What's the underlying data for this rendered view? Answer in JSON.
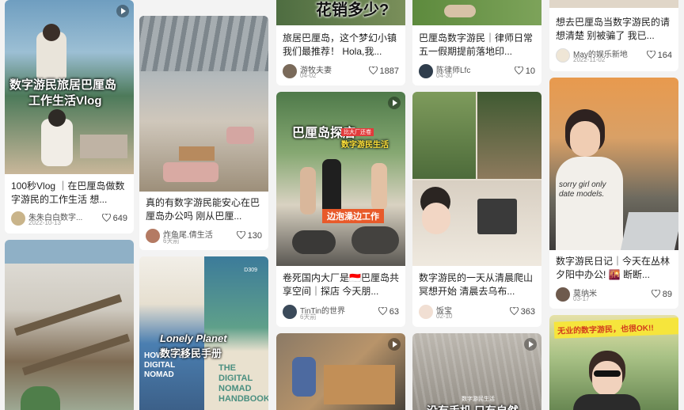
{
  "feed": {
    "col1": [
      {
        "overlay": "数字游民旅居巴厘岛",
        "overlay2": "工作生活Vlog",
        "title": "100秒Vlog ｜在巴厘岛做数字游民的工作生活 想...",
        "author": "朱朱白白数字...",
        "date": "2022-10-13",
        "likes": "649",
        "colors": [
          "#5f8aa6",
          "#3f6a50",
          "#c9b79a"
        ]
      },
      {
        "title": "",
        "colors": [
          "#d9d6cf",
          "#6d5f4a",
          "#a8b5a0"
        ]
      }
    ],
    "col2": [
      {
        "title": "真的有数字游民能安心在巴厘岛办公吗 刚从巴厘...",
        "author": "炸鱼尾.倩生活",
        "date": "6天前",
        "likes": "130",
        "colors": [
          "#9aa3a8",
          "#d6b0a8",
          "#c9a27b"
        ]
      },
      {
        "overlay": "Lonely Planet",
        "overlay2": "数字移民手册",
        "book1": "HOW TO BE A DIGITAL NOMAD",
        "book2": "THE DIGITAL NOMAD HANDBOOK",
        "code": "D309",
        "colors": [
          "#3e6fa6",
          "#e8e2d4",
          "#4f8f7a"
        ]
      }
    ],
    "col3": [
      {
        "overlay": "花销多少?",
        "title": "旅居巴厘岛，这个梦幻小镇我们最推荐！ Hola,我...",
        "author": "游牧夫妻",
        "date": "04-02",
        "likes": "1887",
        "colors": [
          "#5b7a4e",
          "#2b2b2b"
        ]
      },
      {
        "overlay": "巴厘岛探店",
        "overlay2": "数字游民生活",
        "sub": "边泡澡边工作",
        "tag": "比大厂还卷",
        "title": "卷死国内大厂是🇮🇩巴厘岛共享空间｜探店 今天朋...",
        "author": "TinTin的世界",
        "date": "6天前",
        "likes": "63",
        "colors": [
          "#6e8d63",
          "#d8d4c8",
          "#4b4a48"
        ]
      },
      {
        "colors": [
          "#8b7a66",
          "#c69c6d",
          "#3c3a36"
        ]
      }
    ],
    "col4": [
      {
        "title": "巴厘岛数字游民｜律师日常 五一假期提前落地印...",
        "author": "陈律师Lfc",
        "date": "04-30",
        "likes": "10",
        "colors": [
          "#6a8f4a",
          "#d7c9b4"
        ]
      },
      {
        "title": "数字游民的一天从清晨爬山冥想开始 清晨去乌布...",
        "author": "饭宝",
        "date": "02-10",
        "likes": "363",
        "colors": [
          "#4d6b3a",
          "#8d7a5d",
          "#e5ddd0"
        ]
      },
      {
        "overlay": "没有手机 只有自然",
        "sub": "数字游民生活",
        "colors": [
          "#b3aea5",
          "#8f8a82"
        ]
      }
    ],
    "col5": [
      {
        "title": "想去巴厘岛当数字游民的请想清楚 别被骗了 我已...",
        "author": "May的娱乐新地",
        "date": "2022-11-02",
        "likes": "164",
        "colors": [
          "#e0d6c8"
        ]
      },
      {
        "shirt": "sorry girl only date models.",
        "title": "数字游民日记｜今天在丛林夕阳中办公! 🌇 断断...",
        "author": "莫纳米",
        "date": "03-17",
        "likes": "89",
        "colors": [
          "#e7a35a",
          "#3e3b3a",
          "#f0ede8"
        ]
      },
      {
        "banner": "无业的数字游民，也很OK!!",
        "colors": [
          "#d9d94a",
          "#6b8e55",
          "#2b2b2b"
        ]
      }
    ]
  },
  "icons": {
    "like": "heart-outline-icon",
    "video": "play-icon"
  },
  "accent": "#ff2442"
}
